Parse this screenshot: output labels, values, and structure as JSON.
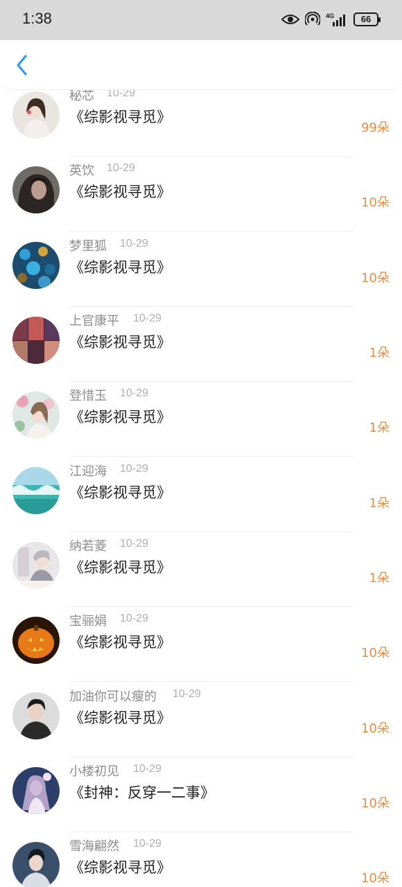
{
  "status_bar": {
    "time": "1:38",
    "battery_level": "66",
    "network": "4G",
    "icons": [
      "eye-icon",
      "hotspot-icon",
      "signal-icon",
      "battery-icon"
    ]
  },
  "header": {
    "back_icon": "chevron-left-icon"
  },
  "colors": {
    "accent": "#2a9bf0",
    "gift_count": "#f08a3c",
    "username": "#8c8c8c",
    "date": "#b0b0b0"
  },
  "records": [
    {
      "user": "秘芯",
      "date": "10-29",
      "book": "《综影视寻觅》",
      "gift": "99朵"
    },
    {
      "user": "英饮",
      "date": "10-29",
      "book": "《综影视寻觅》",
      "gift": "10朵"
    },
    {
      "user": "梦里狐",
      "date": "10-29",
      "book": "《综影视寻觅》",
      "gift": "10朵"
    },
    {
      "user": "上官康平",
      "date": "10-29",
      "book": "《综影视寻觅》",
      "gift": "1朵"
    },
    {
      "user": "登惜玉",
      "date": "10-29",
      "book": "《综影视寻觅》",
      "gift": "1朵"
    },
    {
      "user": "江迎海",
      "date": "10-29",
      "book": "《综影视寻觅》",
      "gift": "1朵"
    },
    {
      "user": "纳若菱",
      "date": "10-29",
      "book": "《综影视寻觅》",
      "gift": "1朵"
    },
    {
      "user": "宝骊娟",
      "date": "10-29",
      "book": "《综影视寻觅》",
      "gift": "10朵"
    },
    {
      "user": "加油你可以瘦的",
      "date": "10-29",
      "book": "《综影视寻觅》",
      "gift": "10朵"
    },
    {
      "user": "小楼初见",
      "date": "10-29",
      "book": "《封神：反穿一二事》",
      "gift": "10朵"
    },
    {
      "user": "雪海翩然",
      "date": "10-29",
      "book": "《综影视寻觅》",
      "gift": "10朵"
    }
  ]
}
